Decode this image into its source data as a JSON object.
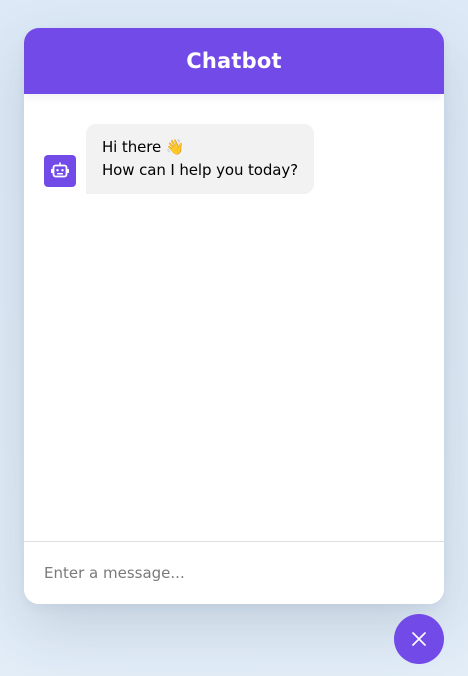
{
  "header": {
    "title": "Chatbot"
  },
  "messages": [
    {
      "sender": "bot",
      "icon": "robot-icon",
      "lines": [
        "Hi there 👋",
        "How can I help you today?"
      ]
    }
  ],
  "input": {
    "placeholder": "Enter a message...",
    "value": ""
  },
  "toggler": {
    "icon": "close-icon"
  },
  "colors": {
    "accent": "#724ae8",
    "bubble": "#f2f2f2",
    "background": "#dde9f6"
  }
}
